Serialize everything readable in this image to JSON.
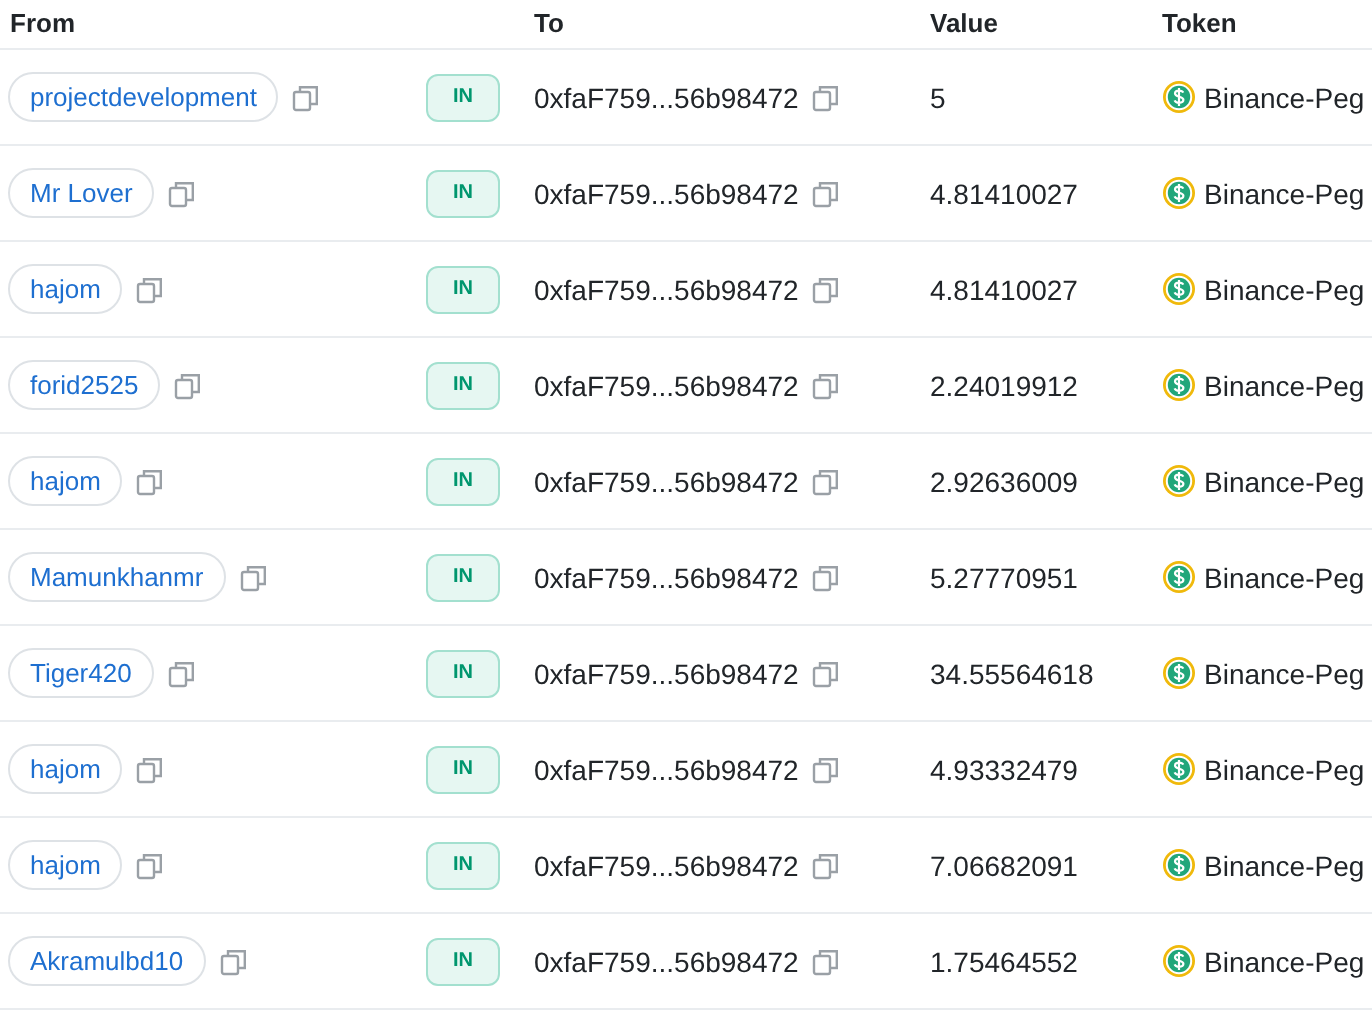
{
  "table": {
    "columns": [
      "From",
      "",
      "To",
      "Value",
      "Token"
    ],
    "rows": [
      {
        "from": "projectdevelopment",
        "direction": "IN",
        "to": "0xfaF759...56b98472",
        "value": "5",
        "token": "Binance-Peg"
      },
      {
        "from": "Mr Lover",
        "direction": "IN",
        "to": "0xfaF759...56b98472",
        "value": "4.81410027",
        "token": "Binance-Peg"
      },
      {
        "from": "hajom",
        "direction": "IN",
        "to": "0xfaF759...56b98472",
        "value": "4.81410027",
        "token": "Binance-Peg"
      },
      {
        "from": "forid2525",
        "direction": "IN",
        "to": "0xfaF759...56b98472",
        "value": "2.24019912",
        "token": "Binance-Peg"
      },
      {
        "from": "hajom",
        "direction": "IN",
        "to": "0xfaF759...56b98472",
        "value": "2.92636009",
        "token": "Binance-Peg"
      },
      {
        "from": "Mamunkhanmr",
        "direction": "IN",
        "to": "0xfaF759...56b98472",
        "value": "5.27770951",
        "token": "Binance-Peg"
      },
      {
        "from": "Tiger420",
        "direction": "IN",
        "to": "0xfaF759...56b98472",
        "value": "34.55564618",
        "token": "Binance-Peg"
      },
      {
        "from": "hajom",
        "direction": "IN",
        "to": "0xfaF759...56b98472",
        "value": "4.93332479",
        "token": "Binance-Peg"
      },
      {
        "from": "hajom",
        "direction": "IN",
        "to": "0xfaF759...56b98472",
        "value": "7.06682091",
        "token": "Binance-Peg"
      },
      {
        "from": "Akramulbd10",
        "direction": "IN",
        "to": "0xfaF759...56b98472",
        "value": "1.75464552",
        "token": "Binance-Peg"
      }
    ]
  }
}
